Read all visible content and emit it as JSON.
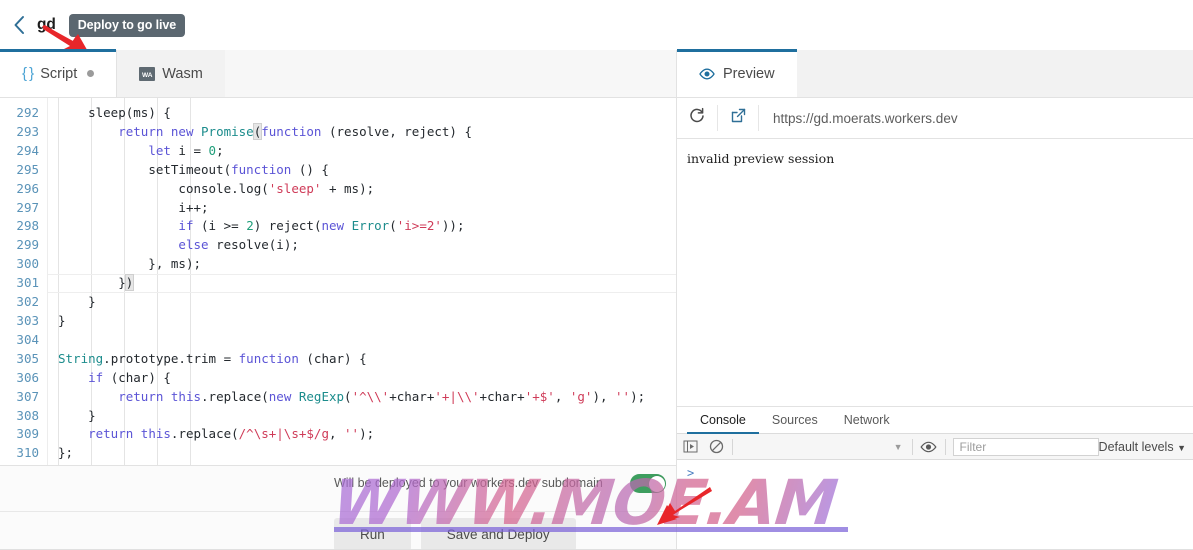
{
  "header": {
    "back_icon": "chevron-left-icon",
    "worker_name": "gd",
    "deploy_badge": "Deploy to go live"
  },
  "editor_tabs": [
    {
      "label": "Script",
      "icon": "curly-braces-icon",
      "has_dot": true,
      "active": true
    },
    {
      "label": "Wasm",
      "icon": "wasm-icon",
      "icon_text": "WA",
      "has_dot": false,
      "active": false
    }
  ],
  "code": {
    "first_line_number": 292,
    "last_line_number": 310,
    "lines": [
      {
        "n": 292,
        "text": "    sleep(ms) {"
      },
      {
        "n": 293,
        "text": "        return new Promise(function (resolve, reject) {"
      },
      {
        "n": 294,
        "text": "            let i = 0;"
      },
      {
        "n": 295,
        "text": "            setTimeout(function () {"
      },
      {
        "n": 296,
        "text": "                console.log('sleep' + ms);"
      },
      {
        "n": 297,
        "text": "                i++;"
      },
      {
        "n": 298,
        "text": "                if (i >= 2) reject(new Error('i>=2'));"
      },
      {
        "n": 299,
        "text": "                else resolve(i);"
      },
      {
        "n": 300,
        "text": "            }, ms);"
      },
      {
        "n": 301,
        "text": "        })"
      },
      {
        "n": 302,
        "text": "    }"
      },
      {
        "n": 303,
        "text": "}"
      },
      {
        "n": 304,
        "text": ""
      },
      {
        "n": 305,
        "text": "String.prototype.trim = function (char) {"
      },
      {
        "n": 306,
        "text": "    if (char) {"
      },
      {
        "n": 307,
        "text": "        return this.replace(new RegExp('^\\\\'+char+'+|\\\\'+char+'+$', 'g'), '');"
      },
      {
        "n": 308,
        "text": "    }"
      },
      {
        "n": 309,
        "text": "    return this.replace(/^\\s+|\\s+$/g, '');"
      },
      {
        "n": 310,
        "text": "};"
      }
    ],
    "cursor_line": 301
  },
  "footer": {
    "note": "Will be deployed to your workers.dev subdomain",
    "toggle_state": "on",
    "run_label": "Run",
    "deploy_label": "Save and Deploy"
  },
  "preview": {
    "tab_label": "Preview",
    "tab_icon": "eye-icon",
    "reload_icon": "reload-icon",
    "open_external_icon": "external-link-icon",
    "url": "https://gd.moerats.workers.dev",
    "body_text": "invalid preview session"
  },
  "devtools": {
    "tabs": [
      {
        "label": "Console",
        "active": true
      },
      {
        "label": "Sources",
        "active": false
      },
      {
        "label": "Network",
        "active": false
      }
    ],
    "toolbar": {
      "context_icon": "execution-context-icon",
      "clear_icon": "clear-console-icon",
      "dropdown_caret": "chevron-down-icon",
      "eye_icon": "live-expression-eye-icon",
      "filter_placeholder": "Filter",
      "levels_label": "Default levels",
      "levels_caret": "▼"
    },
    "prompt_symbol": ">"
  },
  "watermark": {
    "text": "WWW.MOE.AM"
  },
  "colors": {
    "accent": "#1f6f9e",
    "badge_bg": "#5b6770",
    "toggle_on": "#3e9e5f",
    "keyword": "#5b54d6",
    "type": "#1c8c8c",
    "string": "#cf3b58",
    "number": "#1f9e7a",
    "line_number": "#5a93b8",
    "arrow_red": "#e8262a",
    "watermark_purple": "#7b62d8"
  }
}
